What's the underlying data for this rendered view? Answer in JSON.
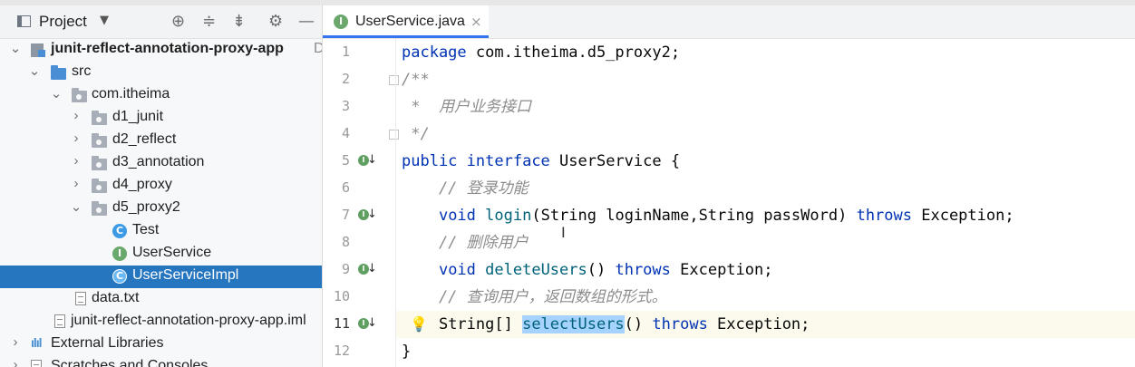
{
  "project_panel": {
    "title": "Project",
    "caret": "▼",
    "toolbar_icons": [
      "crosshair-icon",
      "expand-all-icon",
      "collapse-all-icon",
      "gear-icon",
      "minimize-icon"
    ],
    "tree": [
      {
        "label": "junit-reflect-annotation-proxy-app",
        "suffix": "D",
        "arrow": "⌄"
      },
      {
        "label": "src",
        "arrow": "⌄"
      },
      {
        "label": "com.itheima",
        "arrow": "⌄"
      },
      {
        "label": "d1_junit",
        "arrow": "›"
      },
      {
        "label": "d2_reflect",
        "arrow": "›"
      },
      {
        "label": "d3_annotation",
        "arrow": "›"
      },
      {
        "label": "d4_proxy",
        "arrow": "›"
      },
      {
        "label": "d5_proxy2",
        "arrow": "⌄"
      },
      {
        "label": "Test",
        "icon_letter": "C"
      },
      {
        "label": "UserService",
        "icon_letter": "I"
      },
      {
        "label": "UserServiceImpl",
        "icon_letter": "C"
      },
      {
        "label": "data.txt"
      },
      {
        "label": "junit-reflect-annotation-proxy-app.iml"
      },
      {
        "label": "External Libraries",
        "arrow": "›"
      },
      {
        "label": "Scratches and Consoles",
        "arrow": "›"
      }
    ]
  },
  "editor": {
    "tab": {
      "label": "UserService.java",
      "icon_letter": "I",
      "close": "×"
    },
    "impl_marker_letter": "I",
    "impl_marker_arrow": "↓",
    "lightbulb": "💡",
    "ibeam": "I",
    "line_numbers": [
      "1",
      "2",
      "3",
      "4",
      "5",
      "6",
      "7",
      "8",
      "9",
      "10",
      "11",
      "12"
    ],
    "code": {
      "l1_kw": "package",
      "l1_rest": " com.itheima.d5_proxy2;",
      "l2": "/**",
      "l3": " *  用户业务接口",
      "l4": " */",
      "l5_kw1": "public",
      "l5_kw2": "interface",
      "l5_rest": " UserService {",
      "l6": "    // 登录功能",
      "l7_indent": "    ",
      "l7_kw": "void",
      "l7_fn": "login",
      "l7_args": "(String loginName,String passWord) ",
      "l7_throws": "throws",
      "l7_rest": " Exception;",
      "l8": "    // 删除用户",
      "l9_indent": "    ",
      "l9_kw": "void",
      "l9_fn": "deleteUsers",
      "l9_args": "() ",
      "l9_throws": "throws",
      "l9_rest": " Exception;",
      "l10": "    // 查询用户，返回数组的形式。",
      "l11_indent": "    ",
      "l11_type": "String[] ",
      "l11_fn": "selectUsers",
      "l11_args": "() ",
      "l11_throws": "throws",
      "l11_rest": " Exception;",
      "l12": "}"
    }
  }
}
